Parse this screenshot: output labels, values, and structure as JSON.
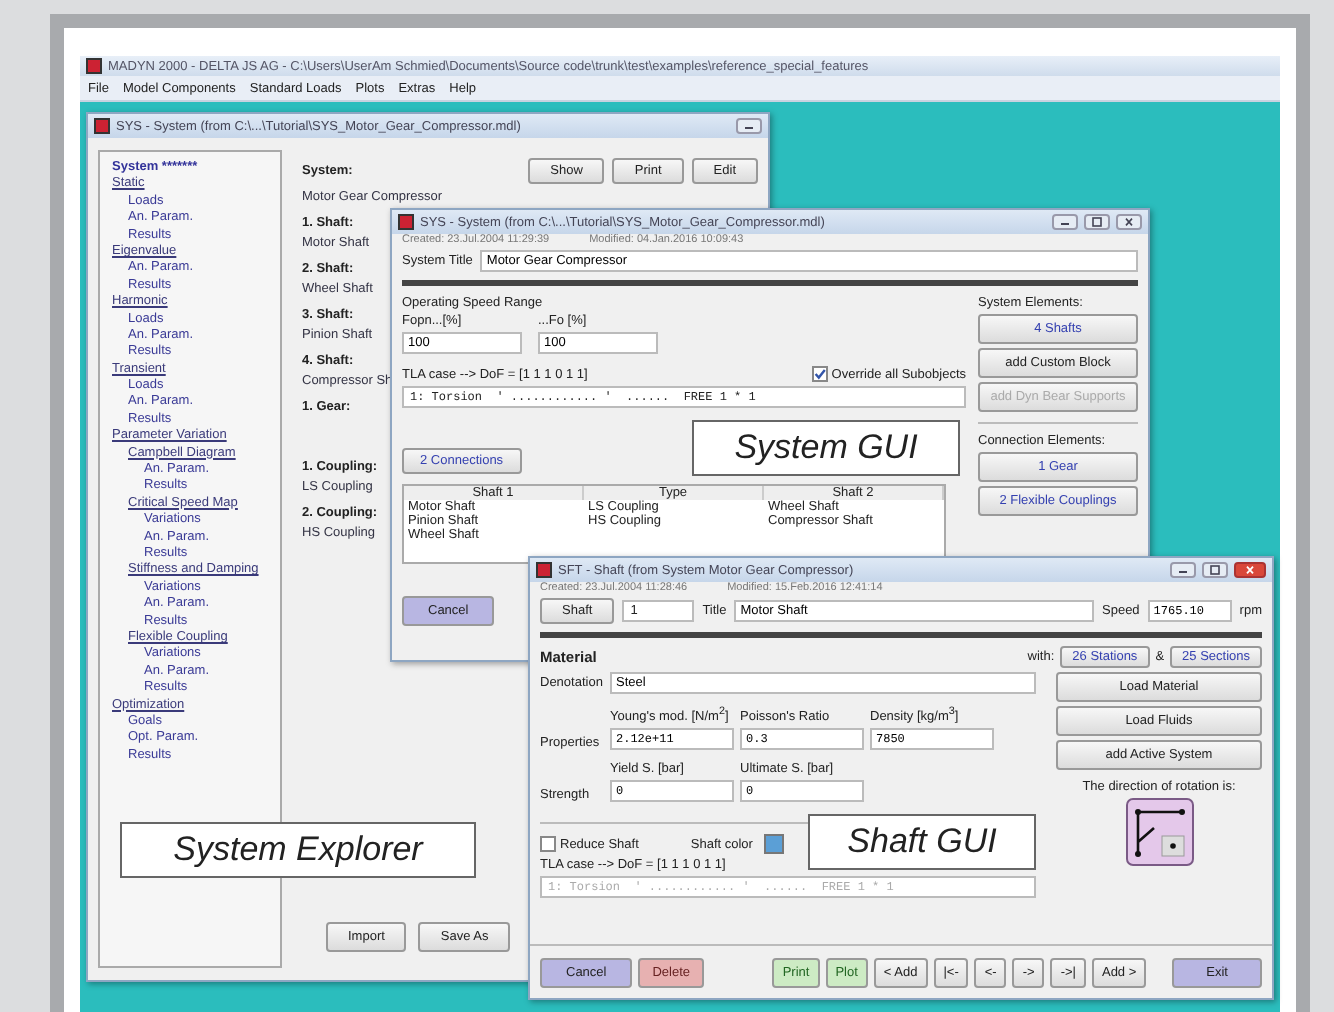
{
  "app": {
    "title": "MADYN 2000 - DELTA JS AG - C:\\Users\\UserAm Schmied\\Documents\\Source code\\trunk\\test\\examples\\reference_special_features",
    "menu": [
      "File",
      "Model Components",
      "Standard Loads",
      "Plots",
      "Extras",
      "Help"
    ]
  },
  "explorer_window": {
    "title": "SYS - System (from C:\\...\\Tutorial\\SYS_Motor_Gear_Compressor.mdl)",
    "tree": [
      {
        "label": "System *******",
        "kind": "root"
      },
      {
        "label": "Static",
        "kind": "section",
        "children": [
          {
            "label": "Loads",
            "kind": "item"
          },
          {
            "label": "An. Param.",
            "kind": "item"
          },
          {
            "label": "Results",
            "kind": "item"
          }
        ]
      },
      {
        "label": "Eigenvalue",
        "kind": "section",
        "children": [
          {
            "label": "An. Param.",
            "kind": "item"
          },
          {
            "label": "Results",
            "kind": "item"
          }
        ]
      },
      {
        "label": "Harmonic",
        "kind": "section",
        "children": [
          {
            "label": "Loads",
            "kind": "item"
          },
          {
            "label": "An. Param.",
            "kind": "item"
          },
          {
            "label": "Results",
            "kind": "item"
          }
        ]
      },
      {
        "label": "Transient",
        "kind": "section",
        "children": [
          {
            "label": "Loads",
            "kind": "item"
          },
          {
            "label": "An. Param.",
            "kind": "item"
          },
          {
            "label": "Results",
            "kind": "item"
          }
        ]
      },
      {
        "label": "Parameter Variation",
        "kind": "section",
        "children": [
          {
            "label": "Campbell Diagram",
            "kind": "section",
            "children": [
              {
                "label": "An. Param.",
                "kind": "item"
              },
              {
                "label": "Results",
                "kind": "item"
              }
            ]
          },
          {
            "label": "Critical Speed Map",
            "kind": "section",
            "children": [
              {
                "label": "Variations",
                "kind": "item"
              },
              {
                "label": "An. Param.",
                "kind": "item"
              },
              {
                "label": "Results",
                "kind": "item"
              }
            ]
          },
          {
            "label": "Stiffness and Damping",
            "kind": "section",
            "children": [
              {
                "label": "Variations",
                "kind": "item"
              },
              {
                "label": "An. Param.",
                "kind": "item"
              },
              {
                "label": "Results",
                "kind": "item"
              }
            ]
          },
          {
            "label": "Flexible Coupling",
            "kind": "section",
            "children": [
              {
                "label": "Variations",
                "kind": "item"
              },
              {
                "label": "An. Param.",
                "kind": "item"
              },
              {
                "label": "Results",
                "kind": "item"
              }
            ]
          }
        ]
      },
      {
        "label": "Optimization",
        "kind": "section",
        "children": [
          {
            "label": "Goals",
            "kind": "item"
          },
          {
            "label": "Opt. Param.",
            "kind": "item"
          },
          {
            "label": "Results",
            "kind": "item"
          }
        ]
      }
    ],
    "heading": "System:",
    "system_name": "Motor Gear Compressor",
    "top_buttons": [
      "Show",
      "Print",
      "Edit"
    ],
    "entry_groups": [
      [
        {
          "label": "1. Shaft:",
          "value": "Motor Shaft"
        },
        {
          "label": "2. Shaft:",
          "value": "Wheel Shaft"
        },
        {
          "label": "3. Shaft:",
          "value": "Pinion Shaft"
        },
        {
          "label": "4. Shaft:",
          "value": "Compressor Sh"
        },
        {
          "label": "1. Gear:"
        }
      ],
      [
        {
          "label": "1. Coupling:",
          "value": "LS Coupling"
        },
        {
          "label": "2. Coupling:",
          "value": "HS Coupling"
        }
      ]
    ],
    "bottom_buttons": [
      "Import",
      "Save As"
    ]
  },
  "system_window": {
    "title": "SYS - System (from C:\\...\\Tutorial\\SYS_Motor_Gear_Compressor.mdl)",
    "created": "Created: 23.Jul.2004 11:29:39",
    "modified": "Modified: 04.Jan.2016 10:09:43",
    "title_label": "System Title",
    "title_value": "Motor Gear Compressor",
    "speed_range_label": "Operating Speed Range",
    "speed_fields": [
      {
        "label": "Fopn...[%]",
        "value": "100"
      },
      {
        "label": "...Fo [%]",
        "value": "100"
      }
    ],
    "tla_label": "TLA case --> DoF = [1 1 1 0 1 1]",
    "tla_value": "1: Torsion  ' ............ '  ......  FREE 1 * 1",
    "override": {
      "label": "Override all Subobjects",
      "checked": true
    },
    "system_elements_label": "System Elements:",
    "system_elements": [
      {
        "label": "4 Shafts",
        "kind": "link",
        "disabled": false
      },
      {
        "label": "add Custom Block",
        "kind": "plain",
        "disabled": false
      },
      {
        "label": "add Dyn Bear Supports",
        "kind": "plain",
        "disabled": true
      }
    ],
    "connection_elements_label": "Connection Elements:",
    "connection_elements": [
      {
        "label": "1 Gear",
        "kind": "link"
      },
      {
        "label": "2 Flexible Couplings",
        "kind": "link"
      }
    ],
    "connections_button": "2 Connections",
    "table": {
      "columns": [
        "Shaft 1",
        "Type",
        "Shaft 2"
      ],
      "rows": [
        [
          "Motor Shaft",
          "LS Coupling",
          "Wheel Shaft"
        ],
        [
          "Pinion Shaft",
          "HS Coupling",
          "Compressor Shaft"
        ],
        [
          "Wheel Shaft"
        ]
      ]
    },
    "cancel_button": "Cancel"
  },
  "shaft_window": {
    "title": "SFT - Shaft (from System Motor Gear Compressor)",
    "created": "Created: 23.Jul.2004 11:28:46",
    "modified": "Modified: 15.Feb.2016 12:41:14",
    "shaft_button": "Shaft",
    "shaft_number": "1",
    "title_label": "Title",
    "title_value": "Motor Shaft",
    "speed_label": "Speed",
    "speed_value": "1765.10",
    "speed_unit": "rpm",
    "material_label": "Material",
    "with_label": "with:",
    "stations_button": "26 Stations",
    "amp": "&",
    "sections_button": "25 Sections",
    "denotation_label": "Denotation",
    "denotation_value": "Steel",
    "properties_label": "Properties",
    "properties": [
      {
        "label": "Young's mod. [N/m$^{2}$]",
        "value": "2.12e+11"
      },
      {
        "label": "Poisson's Ratio",
        "value": "0.3"
      },
      {
        "label": "Density [kg/m$^{3}$]",
        "value": "7850"
      }
    ],
    "strength_label": "Strength",
    "strength": [
      {
        "label": "Yield S. [bar]",
        "value": "0"
      },
      {
        "label": "Ultimate S. [bar]",
        "value": "0"
      }
    ],
    "side_buttons": [
      "Load Material",
      "Load Fluids",
      "add Active System"
    ],
    "rotation_label": "The direction of rotation is:",
    "reduce_shaft": {
      "label": "Reduce Shaft",
      "checked": false
    },
    "shaft_color": {
      "label": "Shaft color",
      "color": "#5b9fd6"
    },
    "tla_label": "TLA case --> DoF = [1 1 1 0 1 1]",
    "tla_value": "1: Torsion  ' ............ '  ......  FREE 1 * 1",
    "tla_disabled": true,
    "buttons": [
      {
        "label": "Cancel",
        "kind": "cancel"
      },
      {
        "label": "Delete",
        "kind": "delete"
      },
      {
        "label": "Print",
        "kind": "green"
      },
      {
        "label": "Plot",
        "kind": "green"
      },
      {
        "label": "< Add",
        "kind": "plain"
      },
      {
        "label": "|<-",
        "kind": "plain"
      },
      {
        "label": "<-",
        "kind": "plain"
      },
      {
        "label": "->",
        "kind": "plain"
      },
      {
        "label": "->|",
        "kind": "plain"
      },
      {
        "label": "Add >",
        "kind": "plain"
      },
      {
        "label": "Exit",
        "kind": "cancel"
      }
    ]
  },
  "callouts": [
    "System Explorer",
    "System GUI",
    "Shaft GUI"
  ]
}
